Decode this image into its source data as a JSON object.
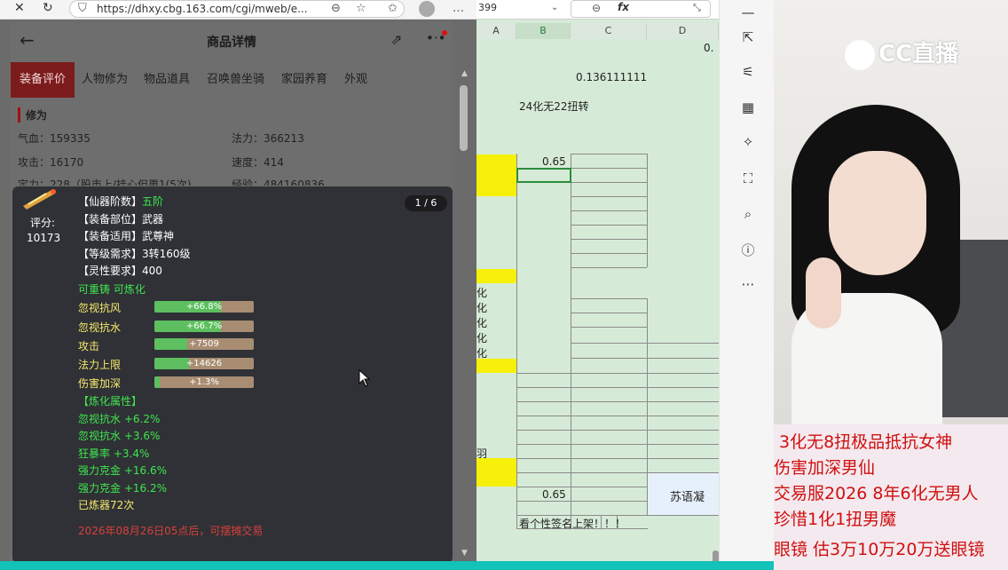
{
  "browser": {
    "url": "https://dhxy.cbg.163.com/cgi/mweb/e...",
    "page_title": "商品详情",
    "tabs": [
      "装备评价",
      "人物修为",
      "物品道具",
      "召唤兽坐骑",
      "家园养育",
      "外观"
    ],
    "section_title": "修为",
    "stats": [
      {
        "label": "气血：",
        "value": "159335"
      },
      {
        "label": "法力：",
        "value": "366213"
      },
      {
        "label": "攻击：",
        "value": "16170"
      },
      {
        "label": "速度：",
        "value": "414"
      },
      {
        "label": "定力：",
        "value": "228（股市上/挂心但更1(5次)"
      },
      {
        "label": "经验：",
        "value": "484160836"
      }
    ]
  },
  "tooltip": {
    "score_label": "评分:",
    "score_value": "10173",
    "pager": "1 / 6",
    "info": [
      {
        "label": "【仙器阶数】",
        "value": "五阶"
      },
      {
        "label": "【装备部位】",
        "value": "武器"
      },
      {
        "label": "【装备适用】",
        "value": "武尊神"
      },
      {
        "label": "【等级需求】",
        "value": "3转160级"
      },
      {
        "label": "【灵性要求】",
        "value": "400"
      }
    ],
    "flags": "可重铸 可炼化",
    "attrs": [
      {
        "name": "忽视抗风",
        "text": "+66.8%",
        "fill": 0.668
      },
      {
        "name": "忽视抗水",
        "text": "+66.7%",
        "fill": 0.667
      },
      {
        "name": "攻击",
        "text": "+7509",
        "fill": 0.33
      },
      {
        "name": "法力上限",
        "text": "+14626",
        "fill": 0.35
      },
      {
        "name": "伤害加深",
        "text": "+1.3%",
        "fill": 0.05
      }
    ],
    "refine_title": "【炼化属性】",
    "refine": [
      "忽视抗水 +6.2%",
      "忽视抗水 +3.6%",
      "狂暴率 +3.4%",
      "强力克金 +16.6%",
      "强力克金 +16.2%"
    ],
    "refine_count": "已炼器72次",
    "trade_note": "2026年08月26日05点后，可摆摊交易"
  },
  "sheet": {
    "name_box": "399",
    "fx": "fx",
    "columns": [
      "A",
      "B",
      "C",
      "D"
    ],
    "cells": {
      "d_top": "0.",
      "c_value": "0.136111111",
      "b_note": "24化无22扭转",
      "b_065": "0.65",
      "b_065_2": "0.65",
      "d_name": "苏语凝",
      "b_sign": "看个性签名上架！！！",
      "a_hua": [
        "化",
        "化",
        "化",
        "化",
        "化"
      ],
      "a_yu": "羽"
    }
  },
  "stream": {
    "logo": "CC直播",
    "captions": [
      "3化无8扭极品抵抗女神",
      "伤害加深男仙",
      "交易服2026 8年6化无男人",
      "珍惜1化1扭男魔",
      "眼镜  估3万10万20万送眼镜"
    ]
  }
}
